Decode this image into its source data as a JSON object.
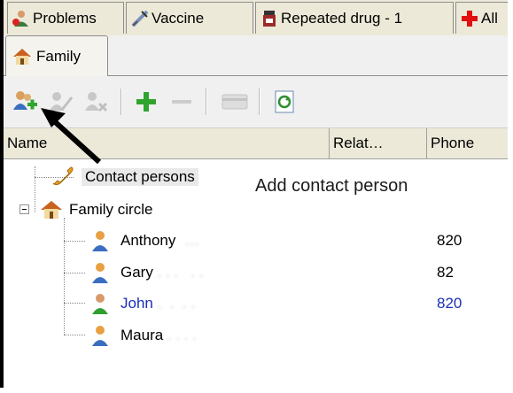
{
  "tabs": {
    "problems": "Problems",
    "vaccine": "Vaccine",
    "repeated_drug": "Repeated drug - 1",
    "all": "All"
  },
  "family_tab": "Family",
  "toolbar": {
    "add_contact": "add-contact",
    "edit_contact": "edit-contact",
    "remove_contact": "remove-contact",
    "add": "add",
    "remove": "remove",
    "card": "card",
    "refresh": "refresh"
  },
  "columns": {
    "name": "Name",
    "relation": "Relat…",
    "phone": "Phone"
  },
  "tree": {
    "contact_persons": "Contact persons",
    "family_circle": "Family circle",
    "members": [
      {
        "name": "Anthony",
        "phone": "820"
      },
      {
        "name": "Gary",
        "phone": "82"
      },
      {
        "name": "John",
        "phone": "820"
      },
      {
        "name": "Maura",
        "phone": ""
      }
    ]
  },
  "callout": "Add contact person",
  "colors": {
    "selected_text": "#1a2fb8",
    "add_green": "#2fa52f",
    "arrow": "#000000"
  }
}
